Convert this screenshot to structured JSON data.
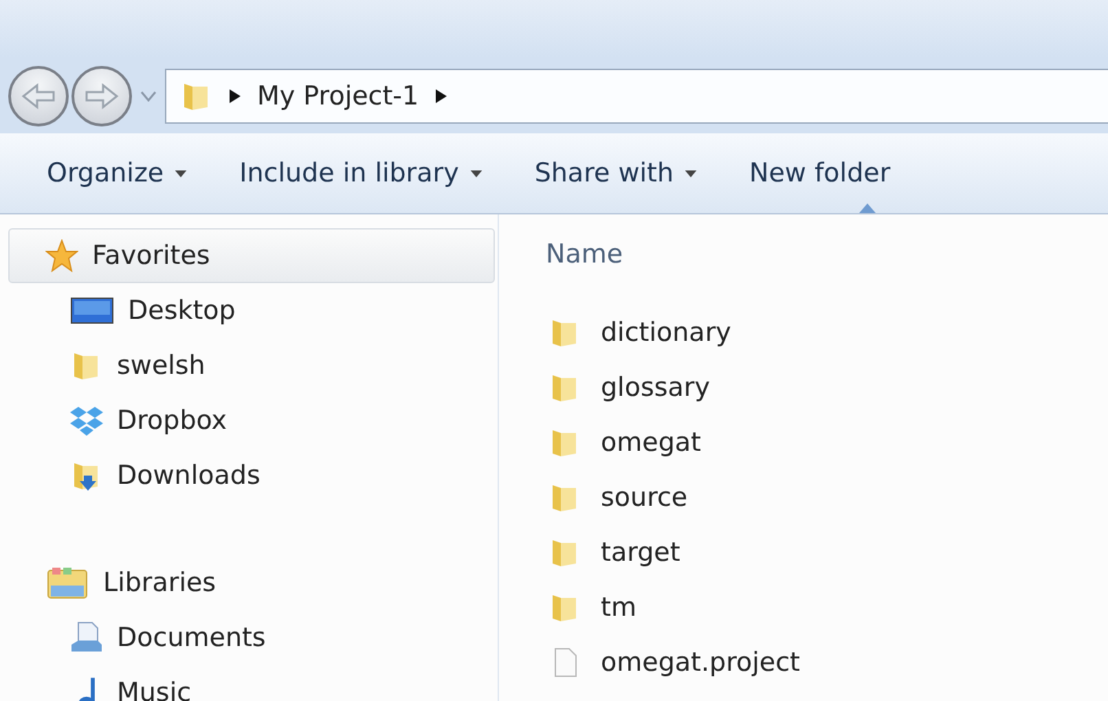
{
  "navigation": {
    "path": [
      "My Project-1"
    ]
  },
  "toolbar": [
    {
      "label": "Organize",
      "has_menu": true
    },
    {
      "label": "Include in library",
      "has_menu": true
    },
    {
      "label": "Share with",
      "has_menu": true
    },
    {
      "label": "New folder",
      "has_menu": false
    }
  ],
  "sidebar": {
    "groups": [
      {
        "label": "Favorites",
        "kind": "star",
        "selected": true,
        "children": [
          {
            "label": "Desktop",
            "kind": "desktop",
            "selected": false
          },
          {
            "label": "swelsh",
            "kind": "folder",
            "selected": false
          },
          {
            "label": "Dropbox",
            "kind": "dropbox",
            "selected": false
          },
          {
            "label": "Downloads",
            "kind": "downloads",
            "selected": false
          }
        ]
      },
      {
        "label": "Libraries",
        "kind": "libraries",
        "selected": false,
        "children": [
          {
            "label": "Documents",
            "kind": "documents",
            "selected": false
          },
          {
            "label": "Music",
            "kind": "music",
            "selected": false
          }
        ]
      }
    ]
  },
  "file_list": {
    "columns": [
      {
        "label": "Name",
        "sorted": true
      }
    ],
    "items": [
      {
        "name": "dictionary",
        "kind": "folder"
      },
      {
        "name": "glossary",
        "kind": "folder"
      },
      {
        "name": "omegat",
        "kind": "folder"
      },
      {
        "name": "source",
        "kind": "folder"
      },
      {
        "name": "target",
        "kind": "folder"
      },
      {
        "name": "tm",
        "kind": "folder"
      },
      {
        "name": "omegat.project",
        "kind": "file"
      }
    ]
  }
}
